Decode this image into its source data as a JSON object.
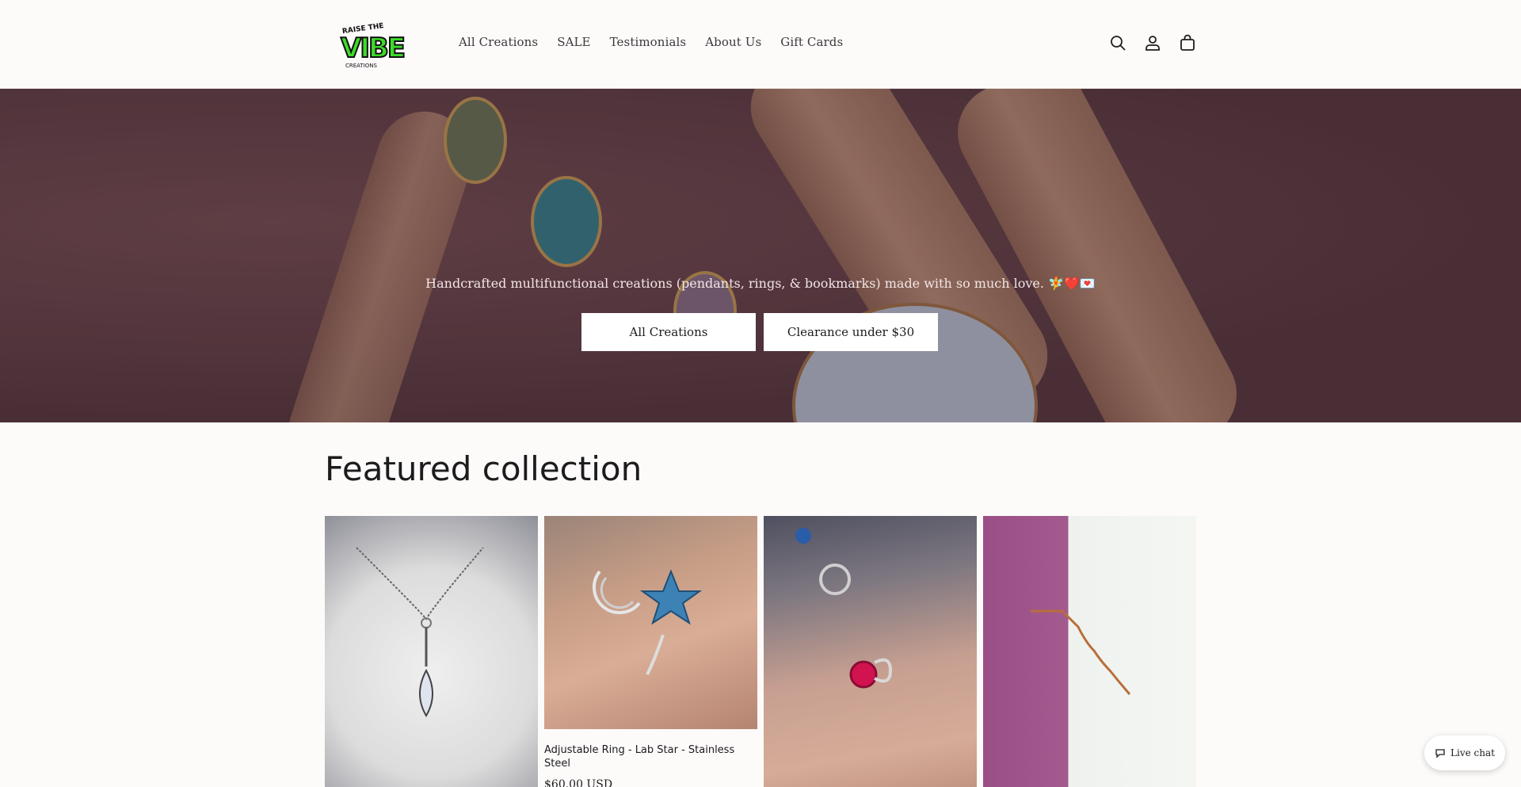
{
  "brand": {
    "logo_top": "RAISE THE",
    "logo_main": "VIBE",
    "logo_bottom": "CREATIONS",
    "accent": "#3ddb2a"
  },
  "nav": {
    "items": [
      "All Creations",
      "SALE",
      "Testimonials",
      "About Us",
      "Gift Cards"
    ]
  },
  "header_icons": [
    "search-icon",
    "account-icon",
    "cart-icon"
  ],
  "hero": {
    "text": "Handcrafted multifunctional creations (pendants, rings, & bookmarks) made with so much love. 🧚❤️💌",
    "buttons": [
      "All Creations",
      "Clearance under $30"
    ]
  },
  "featured": {
    "title": "Featured collection",
    "products": [
      {
        "name": "",
        "price": ""
      },
      {
        "name": "Adjustable Ring - Lab Star - Stainless Steel",
        "price": "$60.00 USD"
      },
      {
        "name": "",
        "price": ""
      },
      {
        "name": "",
        "price": ""
      }
    ]
  },
  "chat": {
    "label": "Live chat"
  }
}
